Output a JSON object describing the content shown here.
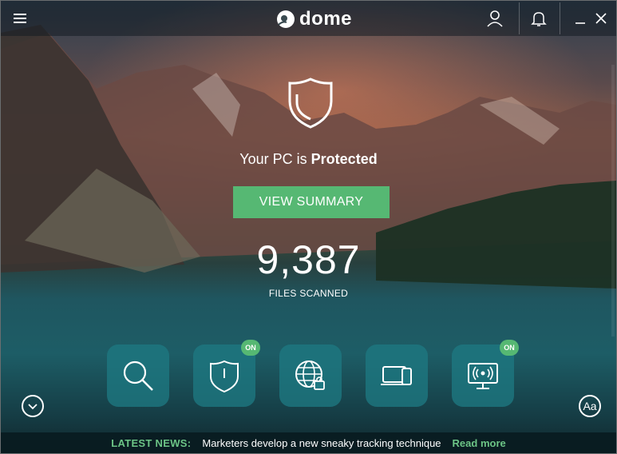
{
  "titlebar": {
    "app_name": "dome",
    "icons": [
      "menu-icon",
      "user-icon",
      "bell-icon",
      "minimize-icon",
      "close-icon"
    ]
  },
  "status": {
    "prefix": "Your PC is ",
    "state": "Protected"
  },
  "summary_button": "VIEW SUMMARY",
  "scan": {
    "count": "9,387",
    "label": "FILES SCANNED"
  },
  "tiles": [
    {
      "icon": "search-icon",
      "badge": ""
    },
    {
      "icon": "shield-icon",
      "badge": "ON"
    },
    {
      "icon": "web-lock-icon",
      "badge": ""
    },
    {
      "icon": "devices-icon",
      "badge": ""
    },
    {
      "icon": "wifi-monitor-icon",
      "badge": "ON"
    }
  ],
  "accessibility_button": "Aa",
  "news": {
    "label": "LATEST NEWS:",
    "headline": "Marketers develop a new sneaky tracking technique",
    "link": "Read more"
  },
  "colors": {
    "accent_green": "#56b873",
    "tile_teal": "#1e7882"
  }
}
